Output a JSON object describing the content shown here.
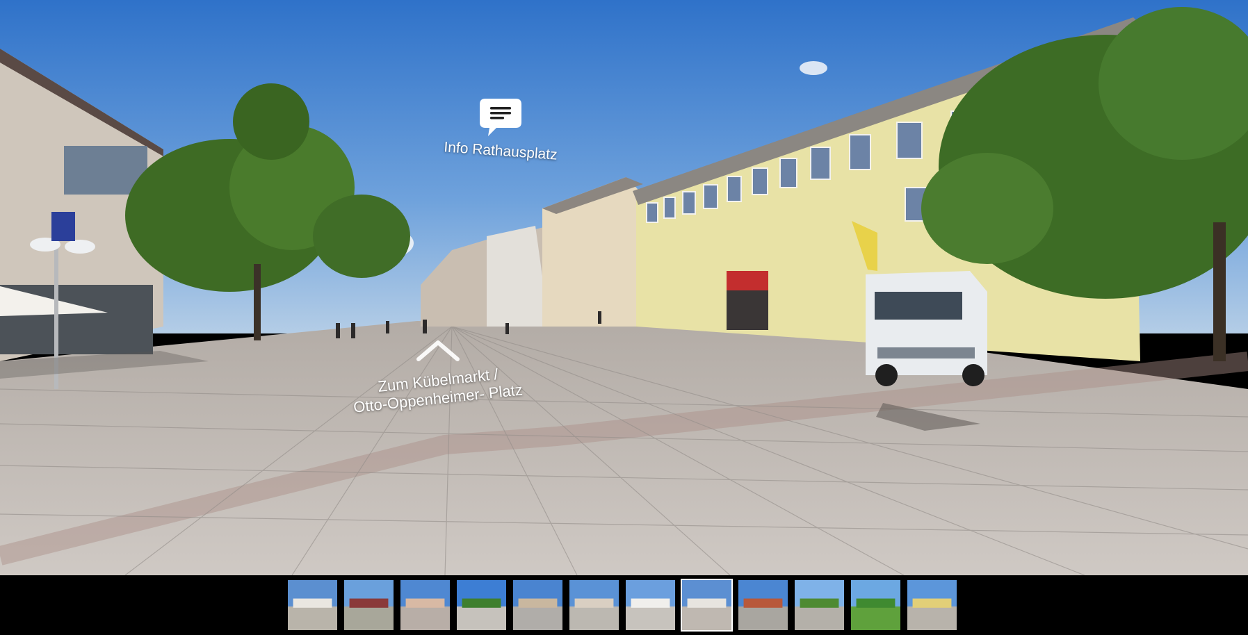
{
  "hotspots": {
    "info": {
      "label": "Info Rathausplatz",
      "icon": "speech-bubble-icon"
    },
    "nav": {
      "label_line1": "Zum Kübelmarkt /",
      "label_line2": "Otto-Oppenheimer- Platz",
      "icon": "chevron-up-icon"
    }
  },
  "filmstrip": {
    "active_index": 7,
    "thumbnails": [
      {
        "sky": "#5b8fd0",
        "ground": "#b9b4aa",
        "feature": "chapel"
      },
      {
        "sky": "#6aa0dc",
        "ground": "#a8a79a",
        "feature": "trees-red"
      },
      {
        "sky": "#4f88d2",
        "ground": "#b8aea7",
        "feature": "palace"
      },
      {
        "sky": "#3d7ed4",
        "ground": "#c6c2bc",
        "feature": "trees-low"
      },
      {
        "sky": "#4a84d0",
        "ground": "#b0ada9",
        "feature": "building-stripes"
      },
      {
        "sky": "#5a92d6",
        "ground": "#bcb8b1",
        "feature": "buildings"
      },
      {
        "sky": "#6b9fde",
        "ground": "#c7c3bd",
        "feature": "buildings-white"
      },
      {
        "sky": "#5c8fd2",
        "ground": "#bfb8b1",
        "feature": "plaza"
      },
      {
        "sky": "#4b86d2",
        "ground": "#a9a6a0",
        "feature": "street-red"
      },
      {
        "sky": "#7fb2e8",
        "ground": "#b4b0a9",
        "feature": "street-trees"
      },
      {
        "sky": "#6ca8e2",
        "ground": "#5fa13c",
        "feature": "park"
      },
      {
        "sky": "#5c96da",
        "ground": "#b8b3ab",
        "feature": "street-yellow"
      }
    ]
  }
}
